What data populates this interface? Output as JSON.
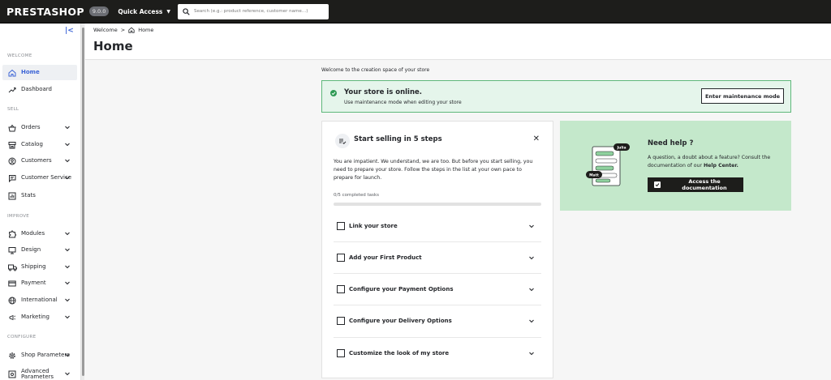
{
  "topbar": {
    "logo": "PRESTASHOP",
    "version": "9.0.0",
    "quick_access": "Quick Access",
    "search_placeholder": "Search (e.g.: product reference, customer name…)"
  },
  "sidebar": {
    "sections": {
      "welcome": "WELCOME",
      "sell": "SELL",
      "improve": "IMPROVE",
      "configure": "CONFIGURE"
    },
    "items": [
      {
        "label": "Home",
        "icon": "home-icon",
        "active": true
      },
      {
        "label": "Dashboard",
        "icon": "trend-icon"
      },
      {
        "label": "Orders",
        "icon": "cart-icon",
        "chevron": true
      },
      {
        "label": "Catalog",
        "icon": "store-icon",
        "chevron": true
      },
      {
        "label": "Customers",
        "icon": "user-icon",
        "chevron": true
      },
      {
        "label": "Customer Service",
        "icon": "chat-icon",
        "chevron": true
      },
      {
        "label": "Stats",
        "icon": "stats-icon"
      },
      {
        "label": "Modules",
        "icon": "puzzle-icon",
        "chevron": true
      },
      {
        "label": "Design",
        "icon": "monitor-icon",
        "chevron": true
      },
      {
        "label": "Shipping",
        "icon": "truck-icon",
        "chevron": true
      },
      {
        "label": "Payment",
        "icon": "card-icon",
        "chevron": true
      },
      {
        "label": "International",
        "icon": "globe-icon",
        "chevron": true
      },
      {
        "label": "Marketing",
        "icon": "megaphone-icon",
        "chevron": true
      },
      {
        "label": "Shop Parameters",
        "icon": "gear-icon",
        "chevron": true
      },
      {
        "label": "Advanced Parameters",
        "icon": "settings-icon",
        "chevron": true
      }
    ]
  },
  "header": {
    "breadcrumb_parent": "Welcome",
    "breadcrumb_sep": ">",
    "breadcrumb_current": "Home",
    "title": "Home"
  },
  "main": {
    "welcome": "Welcome to the creation space of your store",
    "online": {
      "title": "Your store is online.",
      "subtitle": "Use maintenance mode when editing your store",
      "button": "Enter maintenance mode"
    },
    "steps": {
      "title": "Start selling in 5 steps",
      "close": "✕",
      "description": "You are impatient. We understand, we are too. But before you start selling, you need to prepare your store. Follow the steps in the list at your own pace to prepare for launch.",
      "progress_label": "0/5 completed tasks",
      "progress": 0,
      "tasks": [
        {
          "label": "Link your store"
        },
        {
          "label": "Add your First Product"
        },
        {
          "label": "Configure your Payment Options"
        },
        {
          "label": "Configure your Delivery Options"
        },
        {
          "label": "Customize the look of my store"
        }
      ]
    },
    "help": {
      "title": "Need help ?",
      "text": "A question, a doubt about a feature? Consult the documentation of our ",
      "text_bold": "Help Center.",
      "button": "Access the documentation",
      "bubble_1": "Julia",
      "bubble_2": "Matt"
    }
  },
  "colors": {
    "accent": "#3c64d6",
    "success": "#2f9a55",
    "help_bg": "#c4e8cb",
    "online_bg": "#e5f5eb"
  }
}
